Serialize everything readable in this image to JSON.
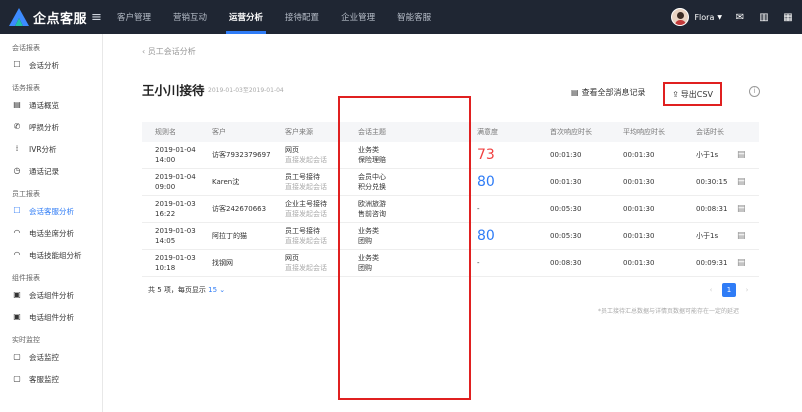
{
  "brand": {
    "name": "企点客服"
  },
  "nav": {
    "items": [
      "客户管理",
      "营销互动",
      "运营分析",
      "接待配置",
      "企业管理",
      "智能客服"
    ],
    "active_index": 2
  },
  "user": {
    "name": "Flora"
  },
  "sidebar": {
    "groups": [
      {
        "label": "会话报表",
        "items": [
          {
            "label": "会话分析",
            "icon": "chat-analysis-icon",
            "glyph": "☐"
          }
        ]
      },
      {
        "label": "话务报表",
        "items": [
          {
            "label": "通话概览",
            "icon": "overview-icon",
            "glyph": "▤"
          },
          {
            "label": "呼损分析",
            "icon": "call-loss-icon",
            "glyph": "✆"
          },
          {
            "label": "IVR分析",
            "icon": "ivr-icon",
            "glyph": "⁞"
          },
          {
            "label": "通话记录",
            "icon": "record-icon",
            "glyph": "◷"
          }
        ]
      },
      {
        "label": "员工报表",
        "items": [
          {
            "label": "会话客服分析",
            "icon": "agent-chat-icon",
            "glyph": "☐",
            "active": true
          },
          {
            "label": "电话坐席分析",
            "icon": "headset-icon",
            "glyph": "◠"
          },
          {
            "label": "电话技能组分析",
            "icon": "headset-group-icon",
            "glyph": "◠"
          }
        ]
      },
      {
        "label": "组件报表",
        "items": [
          {
            "label": "会话组件分析",
            "icon": "widget-chat-icon",
            "glyph": "▣"
          },
          {
            "label": "电话组件分析",
            "icon": "widget-phone-icon",
            "glyph": "▣"
          }
        ]
      },
      {
        "label": "实时监控",
        "items": [
          {
            "label": "会话监控",
            "icon": "monitor-chat-icon",
            "glyph": "▢"
          },
          {
            "label": "客服监控",
            "icon": "monitor-agent-icon",
            "glyph": "▢"
          }
        ]
      }
    ]
  },
  "breadcrumb": {
    "back": "‹",
    "label": "员工会话分析"
  },
  "title": "王小川接待",
  "date_range": "2019-01-03至2019-01-04",
  "actions": {
    "view_all": "查看全部消息记录",
    "export": "导出CSV"
  },
  "table": {
    "headers": [
      "规则名",
      "客户",
      "客户来源",
      "会话主题",
      "满意度",
      "首次响应时长",
      "平均响应时长",
      "会话时长"
    ],
    "rows": [
      {
        "time": [
          "2019-01-04",
          "14:00"
        ],
        "customer": "访客7932379697",
        "source": [
          "网页",
          "直接发起会话"
        ],
        "topic": [
          "业务类",
          "保险理赔"
        ],
        "satisfaction": "73",
        "sat_color": "red",
        "first": "00:01:30",
        "avg": "00:01:30",
        "duration": "小于1s"
      },
      {
        "time": [
          "2019-01-04",
          "09:00"
        ],
        "customer": "Karen沈",
        "source": [
          "员工号接待",
          "直接发起会话"
        ],
        "topic": [
          "会员中心",
          "积分兑换"
        ],
        "satisfaction": "80",
        "sat_color": "blue",
        "first": "00:01:30",
        "avg": "00:01:30",
        "duration": "00:30:15"
      },
      {
        "time": [
          "2019-01-03",
          "16:22"
        ],
        "customer": "访客242670663",
        "source": [
          "企业主号接待",
          "直接发起会话"
        ],
        "topic": [
          "欧洲旅游",
          "售前咨询"
        ],
        "satisfaction": "-",
        "sat_color": "none",
        "first": "00:05:30",
        "avg": "00:01:30",
        "duration": "00:08:31"
      },
      {
        "time": [
          "2019-01-03",
          "14:05"
        ],
        "customer": "阿拉丁的猫",
        "source": [
          "员工号接待",
          "直接发起会话"
        ],
        "topic": [
          "业务类",
          "团购"
        ],
        "satisfaction": "80",
        "sat_color": "blue",
        "first": "00:05:30",
        "avg": "00:01:30",
        "duration": "小于1s"
      },
      {
        "time": [
          "2019-01-03",
          "10:18"
        ],
        "customer": "找钢网",
        "source": [
          "网页",
          "直接发起会话"
        ],
        "topic": [
          "业务类",
          "团购"
        ],
        "satisfaction": "-",
        "sat_color": "none",
        "first": "00:08:30",
        "avg": "00:01:30",
        "duration": "00:09:31"
      }
    ]
  },
  "footer": {
    "summary": "共 5 项，每页显示",
    "page_size": "15",
    "page_size_caret": "⌄",
    "current_page": "1",
    "note": "*员工接待汇总数据与详情页数据可能存在一定的延迟"
  },
  "colors": {
    "accent": "#2f7cf6",
    "red": "#f04040",
    "topbar": "#1f2633",
    "highlight": "#e02020"
  }
}
